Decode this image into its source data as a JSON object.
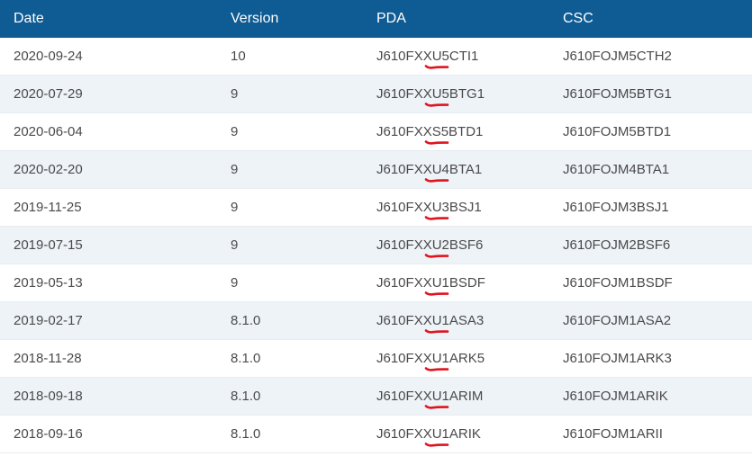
{
  "table": {
    "headers": {
      "date": "Date",
      "version": "Version",
      "pda": "PDA",
      "csc": "CSC"
    },
    "rows": [
      {
        "date": "2020-09-24",
        "version": "10",
        "pda": "J610FXXU5CTI1",
        "csc": "J610FOJM5CTH2"
      },
      {
        "date": "2020-07-29",
        "version": "9",
        "pda": "J610FXXU5BTG1",
        "csc": "J610FOJM5BTG1"
      },
      {
        "date": "2020-06-04",
        "version": "9",
        "pda": "J610FXXS5BTD1",
        "csc": "J610FOJM5BTD1"
      },
      {
        "date": "2020-02-20",
        "version": "9",
        "pda": "J610FXXU4BTA1",
        "csc": "J610FOJM4BTA1"
      },
      {
        "date": "2019-11-25",
        "version": "9",
        "pda": "J610FXXU3BSJ1",
        "csc": "J610FOJM3BSJ1"
      },
      {
        "date": "2019-07-15",
        "version": "9",
        "pda": "J610FXXU2BSF6",
        "csc": "J610FOJM2BSF6"
      },
      {
        "date": "2019-05-13",
        "version": "9",
        "pda": "J610FXXU1BSDF",
        "csc": "J610FOJM1BSDF"
      },
      {
        "date": "2019-02-17",
        "version": "8.1.0",
        "pda": "J610FXXU1ASA3",
        "csc": "J610FOJM1ASA2"
      },
      {
        "date": "2018-11-28",
        "version": "8.1.0",
        "pda": "J610FXXU1ARK5",
        "csc": "J610FOJM1ARK3"
      },
      {
        "date": "2018-09-18",
        "version": "8.1.0",
        "pda": "J610FXXU1ARIM",
        "csc": "J610FOJM1ARIK"
      },
      {
        "date": "2018-09-16",
        "version": "8.1.0",
        "pda": "J610FXXU1ARIK",
        "csc": "J610FOJM1ARII"
      }
    ]
  },
  "colors": {
    "header_bg": "#0f5b93",
    "row_alt_bg": "#eef3f8",
    "annotation": "#e0141e"
  }
}
